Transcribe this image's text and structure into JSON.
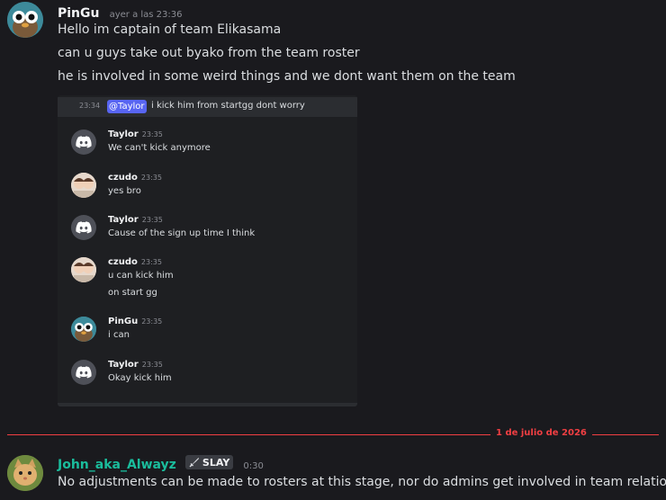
{
  "messages": {
    "pingu": {
      "author": "PinGu",
      "timestamp": "ayer a las 23:36",
      "lines": [
        "Hello im captain of team Elikasama",
        "can u guys take out byako from the team roster",
        "he is involved in some weird things and we dont want them on the team"
      ]
    },
    "john": {
      "author": "John_aka_Alwayz",
      "author_color": "#1abc9c",
      "badge_icon": "sword-icon",
      "badge_label": "SLAY",
      "timestamp": "0:30",
      "text": "No adjustments can be made to rosters at this stage, nor do admins get involved in team relations"
    }
  },
  "embed": {
    "top_time": "23:34",
    "top_mention": "@Taylor",
    "top_text": "i kick him from startgg dont worry",
    "messages": [
      {
        "author": "Taylor",
        "time": "23:35",
        "lines": [
          "We can't kick anymore"
        ]
      },
      {
        "author": "czudo",
        "time": "23:35",
        "lines": [
          "yes bro"
        ]
      },
      {
        "author": "Taylor",
        "time": "23:35",
        "lines": [
          "Cause of the sign up time I think"
        ]
      },
      {
        "author": "czudo",
        "time": "23:35",
        "lines": [
          "u can kick him",
          "on start gg"
        ]
      },
      {
        "author": "PinGu",
        "time": "23:35",
        "lines": [
          "i can"
        ]
      },
      {
        "author": "Taylor",
        "time": "23:35",
        "lines": [
          "Okay kick him"
        ]
      }
    ]
  },
  "divider": {
    "label": "1 de julio de 2026"
  },
  "colors": {
    "background": "#1a1a1e",
    "mention": "#5865f2",
    "divider": "#f23f43"
  }
}
